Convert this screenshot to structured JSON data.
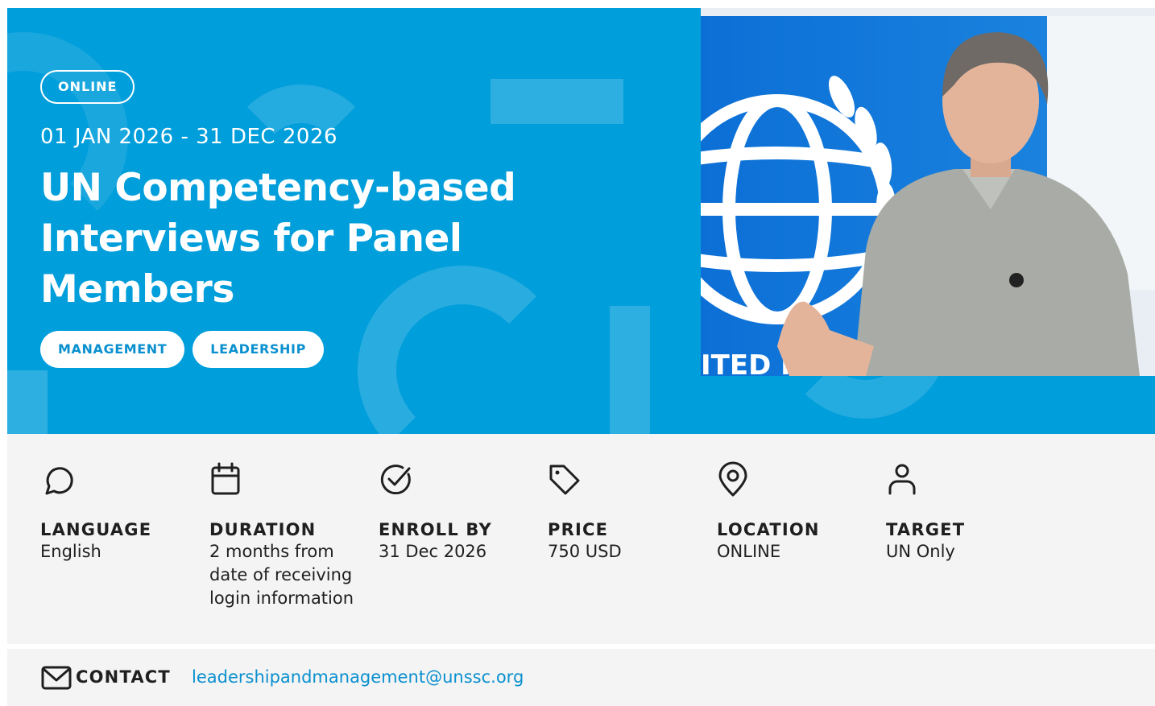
{
  "hero": {
    "badge": "ONLINE",
    "date_range": "01 JAN 2026 - 31 DEC 2026",
    "title": "UN Competency-based Interviews for Panel Members",
    "tags": [
      "MANAGEMENT",
      "LEADERSHIP"
    ],
    "colors": {
      "background": "#009edb",
      "accent": "#0a90cf"
    }
  },
  "details": {
    "items": [
      {
        "icon": "chat-bubble-icon",
        "label": "LANGUAGE",
        "value": "English"
      },
      {
        "icon": "calendar-icon",
        "label": "DURATION",
        "value": "2 months from date of receiving login information"
      },
      {
        "icon": "check-circle-icon",
        "label": "ENROLL BY",
        "value": "31 Dec 2026"
      },
      {
        "icon": "price-tag-icon",
        "label": "PRICE",
        "value": "750 USD"
      },
      {
        "icon": "map-pin-icon",
        "label": "LOCATION",
        "value": "ONLINE"
      },
      {
        "icon": "person-icon",
        "label": "TARGET",
        "value": "UN Only"
      }
    ]
  },
  "contact": {
    "icon": "envelope-icon",
    "label": "CONTACT",
    "email": "leadershipandmanagement@unssc.org"
  }
}
